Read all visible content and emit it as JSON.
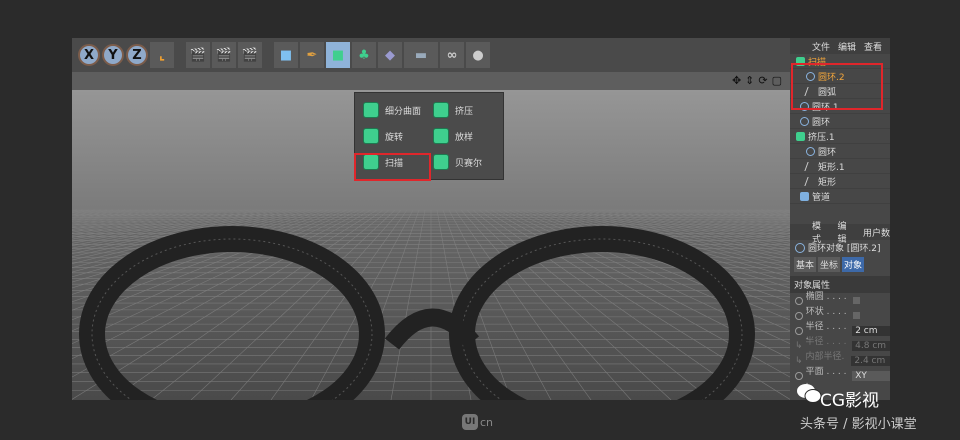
{
  "toolbar": {
    "axes": [
      "X",
      "Y",
      "Z"
    ]
  },
  "menu": {
    "items": [
      {
        "label": "细分曲面",
        "icon": "subdivision-surface-icon"
      },
      {
        "label": "挤压",
        "icon": "extrude-icon"
      },
      {
        "label": "旋转",
        "icon": "lathe-icon"
      },
      {
        "label": "放样",
        "icon": "loft-icon"
      },
      {
        "label": "扫描",
        "icon": "sweep-icon"
      },
      {
        "label": "贝赛尔",
        "icon": "bezier-icon"
      }
    ]
  },
  "object_manager": {
    "menu": [
      "文件",
      "编辑",
      "查看"
    ],
    "tree": [
      {
        "label": "扫描",
        "depth": 0
      },
      {
        "label": "圆环.2",
        "depth": 1
      },
      {
        "label": "圆弧",
        "depth": 1
      },
      {
        "label": "圆环.1",
        "depth": 0
      },
      {
        "label": "圆环",
        "depth": 0
      },
      {
        "label": "挤压.1",
        "depth": 0
      },
      {
        "label": "圆环",
        "depth": 1
      },
      {
        "label": "矩形.1",
        "depth": 1
      },
      {
        "label": "矩形",
        "depth": 1
      },
      {
        "label": "管道",
        "depth": 0
      }
    ]
  },
  "attributes": {
    "menu": [
      "模式",
      "编辑",
      "用户数"
    ],
    "title": "圆环对象 [圆环.2]",
    "tabs": [
      "基本",
      "坐标",
      "对象"
    ],
    "section": "对象属性",
    "fields": [
      {
        "label": "椭圆 . . . . .",
        "value": ""
      },
      {
        "label": "环状 . . . . .",
        "value": ""
      },
      {
        "label": "半径 . . . . .",
        "value": "2 cm"
      },
      {
        "label": "半径 . . . . .",
        "value": "4.8 cm"
      },
      {
        "label": "内部半径. .",
        "value": "2.4 cm"
      },
      {
        "label": "平面 . . . . .",
        "value": "XY"
      }
    ]
  },
  "watermark": {
    "brand": "CG影视",
    "sub": "头条号 / 影视小课堂",
    "site": "cn",
    "logo": "UI"
  }
}
